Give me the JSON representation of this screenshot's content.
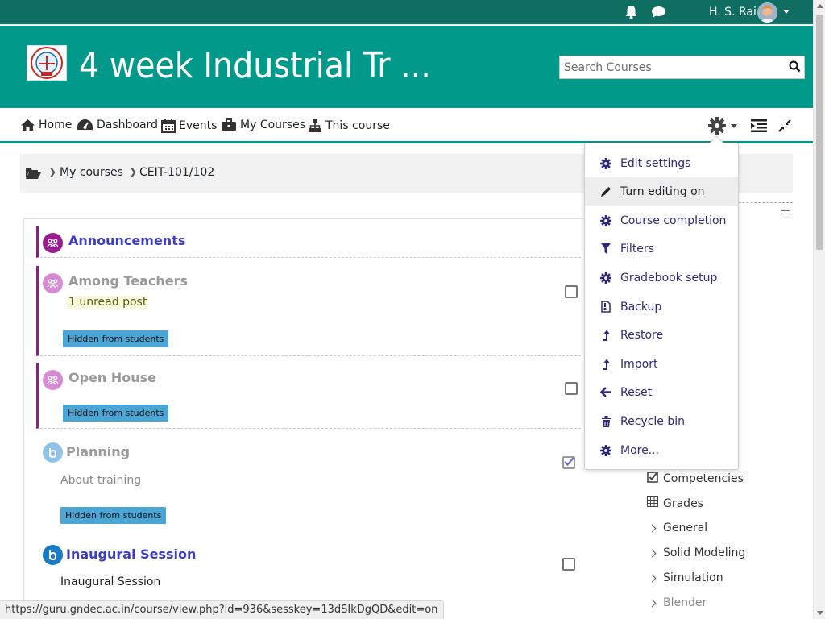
{
  "topbar": {
    "user_name": "H. S. Rai"
  },
  "header": {
    "site_title": "4 week Industrial Tr ...",
    "search_placeholder": "Search Courses"
  },
  "nav": {
    "items": [
      {
        "label": "Home",
        "icon": "home-icon"
      },
      {
        "label": "Dashboard",
        "icon": "dashboard-icon"
      },
      {
        "label": "Events",
        "icon": "calendar-icon"
      },
      {
        "label": "My Courses",
        "icon": "briefcase-icon"
      },
      {
        "label": "This course",
        "icon": "sitemap-icon"
      }
    ]
  },
  "breadcrumb": {
    "items": [
      "My courses",
      "CEIT-101/102"
    ]
  },
  "activities": [
    {
      "title": "Announcements"
    },
    {
      "title": "Among Teachers",
      "unread": "1 unread post",
      "badge": "Hidden from students"
    },
    {
      "title": "Open House",
      "badge": "Hidden from students"
    },
    {
      "title": "Planning",
      "description": "About training",
      "badge": "Hidden from students"
    },
    {
      "title": "Inaugural Session",
      "description": "Inaugural Session"
    }
  ],
  "menu": {
    "items": [
      {
        "label": "Edit settings",
        "icon": "gear-icon"
      },
      {
        "label": "Turn editing on",
        "icon": "pencil-icon"
      },
      {
        "label": "Course completion",
        "icon": "gear-icon"
      },
      {
        "label": "Filters",
        "icon": "filter-icon"
      },
      {
        "label": "Gradebook setup",
        "icon": "gear-icon"
      },
      {
        "label": "Backup",
        "icon": "file-archive-icon"
      },
      {
        "label": "Restore",
        "icon": "level-up-icon"
      },
      {
        "label": "Import",
        "icon": "level-up-icon"
      },
      {
        "label": "Reset",
        "icon": "arrow-left-icon"
      },
      {
        "label": "Recycle bin",
        "icon": "trash-icon"
      },
      {
        "label": "More...",
        "icon": "gear-icon"
      }
    ]
  },
  "course_nav": {
    "items": [
      "Competencies",
      "Grades",
      "General",
      "Solid Modeling",
      "Simulation",
      "Blender"
    ]
  },
  "status_url": "https://guru.gndec.ac.in/course/view.php?id=936&sesskey=13dSIkDgQD&edit=on",
  "colors": {
    "header": "#00998a",
    "topbar": "#0f6e62",
    "link": "#3d3dc4",
    "menu_link": "#2d2a7b",
    "badge": "#4ba6d6",
    "forum_bar": "#8e1a8e"
  }
}
